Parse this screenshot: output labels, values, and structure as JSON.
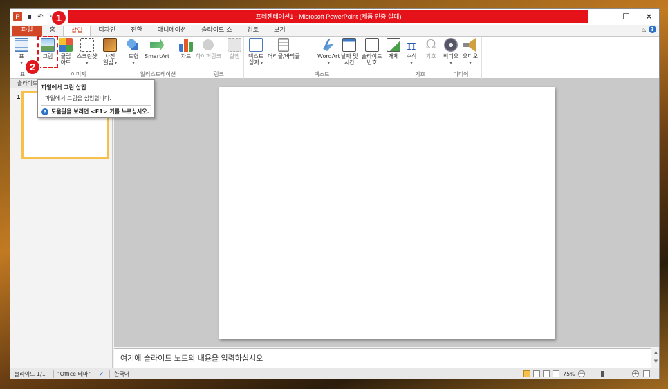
{
  "window": {
    "title": "프레젠테이션1 - Microsoft PowerPoint (제품 인증 실패)",
    "app_icon": "P",
    "controls": {
      "minimize": "—",
      "maximize": "☐",
      "close": "✕"
    }
  },
  "tabs": [
    {
      "label": "파일"
    },
    {
      "label": "홈"
    },
    {
      "label": "삽입"
    },
    {
      "label": "디자인"
    },
    {
      "label": "전환"
    },
    {
      "label": "애니메이션"
    },
    {
      "label": "슬라이드 쇼"
    },
    {
      "label": "검토"
    },
    {
      "label": "보기"
    }
  ],
  "ribbon": {
    "groups": {
      "table": "표",
      "image": "이미지",
      "illustration": "일러스트레이션",
      "link": "링크",
      "text": "텍스트",
      "symbol": "기호",
      "media": "미디어"
    },
    "buttons": {
      "table": "표",
      "picture": "그림",
      "clipart_1": "클립",
      "clipart_2": "아트",
      "screenshot": "스크린샷",
      "album_1": "사진",
      "album_2": "앨범",
      "shapes": "도형",
      "smartart": "SmartArt",
      "chart": "차트",
      "hyperlink": "하이퍼링크",
      "action": "실행",
      "textbox_1": "텍스트",
      "textbox_2": "상자",
      "header_footer": "머리글/바닥글",
      "wordart": "WordArt",
      "datetime_1": "날짜 및",
      "datetime_2": "시간",
      "slidenum_1": "슬라이드",
      "slidenum_2": "번호",
      "object": "개체",
      "equation": "수식",
      "symbol": "기호",
      "video": "비디오",
      "audio": "오디오"
    }
  },
  "side_panel": {
    "header": "슬라이드",
    "slide_number": "1"
  },
  "tooltip": {
    "title": "파일에서 그림 삽입",
    "description": "파일에서 그림을 삽입합니다.",
    "help": "도움말을 보려면 <F1> 키를 누르십시오.",
    "help_icon": "?"
  },
  "notes": {
    "placeholder": "여기에 슬라이드 노트의 내용을 입력하십시오"
  },
  "status": {
    "slide": "슬라이드 1/1",
    "theme": "\"Office 테마\"",
    "language": "한국어",
    "zoom": "75%"
  },
  "callouts": {
    "one": "1",
    "two": "2"
  },
  "colors": {
    "accent": "#d24726",
    "title_bar": "#e6121a",
    "callout": "#e0181e",
    "thumbnail_border": "#f6c04a"
  }
}
